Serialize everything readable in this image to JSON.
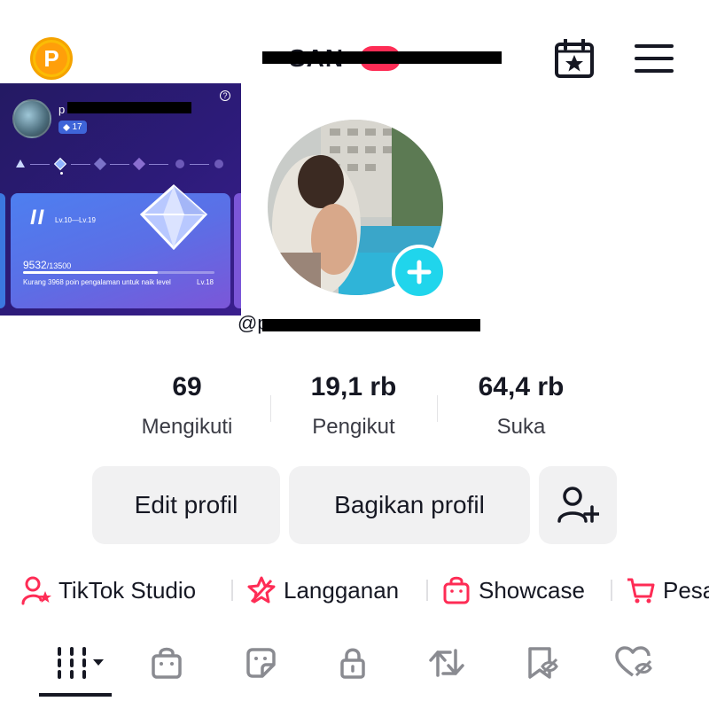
{
  "header": {
    "points_icon_letter": "P",
    "title": "SAN",
    "calendar_icon": "calendar-star-icon",
    "menu_icon": "hamburger-menu-icon"
  },
  "level_card": {
    "username": "p",
    "level_badge": "17",
    "tier_roman": "II",
    "tier_range": "Lv.10—Lv.19",
    "xp_current": "9532",
    "xp_total": "/13500",
    "xp_progress": 0.706,
    "message": "Kurang 3968 poin pengalaman untuk naik level",
    "next_level": "Lv.18",
    "help_icon": "?"
  },
  "profile": {
    "handle": "@p",
    "add_icon": "plus-icon"
  },
  "stats": [
    {
      "value": "69",
      "label": "Mengikuti"
    },
    {
      "value": "19,1 rb",
      "label": "Pengikut"
    },
    {
      "value": "64,4 rb",
      "label": "Suka"
    }
  ],
  "actions": {
    "edit_label": "Edit profil",
    "share_label": "Bagikan profil",
    "add_friend_icon": "add-user-icon"
  },
  "quick_links": [
    {
      "label": "TikTok Studio",
      "icon": "studio-user-icon"
    },
    {
      "label": "Langganan",
      "icon": "subscription-icon"
    },
    {
      "label": "Showcase",
      "icon": "showcase-bag-icon"
    },
    {
      "label": "Pesa",
      "icon": "cart-icon"
    }
  ],
  "tabs": [
    {
      "icon": "grid-videos-icon",
      "active": true
    },
    {
      "icon": "shop-bag-icon"
    },
    {
      "icon": "sticker-icon"
    },
    {
      "icon": "lock-icon"
    },
    {
      "icon": "repost-icon"
    },
    {
      "icon": "favorites-icon"
    },
    {
      "icon": "liked-hidden-icon"
    }
  ],
  "colors": {
    "accent": "#fe2c55",
    "teal": "#20d5ec",
    "button_bg": "#f1f1f2",
    "text": "#161823",
    "card_bg": "#2d1b7a"
  }
}
